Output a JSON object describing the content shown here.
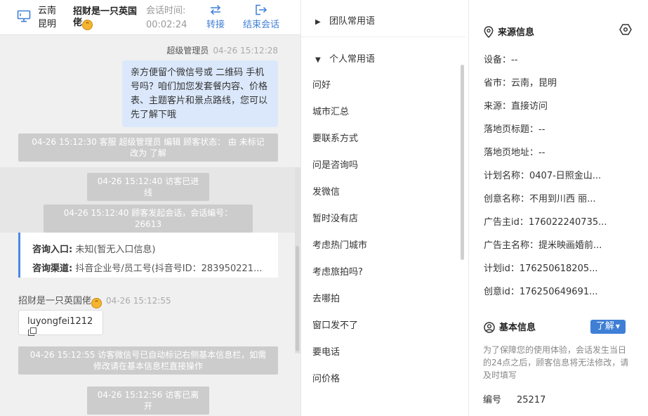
{
  "header": {
    "province": "云南",
    "city": "昆明",
    "visitor_name": "招财是一只英国佬",
    "session_time_label": "会话时间:",
    "session_time_value": "00:02:24",
    "transfer_label": "转接",
    "end_label": "结束会话"
  },
  "messages": {
    "agent_name": "超级管理员",
    "agent_time": "04-26 15:12:28",
    "agent_text": "亲方便留个微信号或 二维码 手机号吗？咱们加您发套餐内容、价格表、主题客片和景点路线，您可以先了解下哦",
    "sys1": "04-26 15:12:30 客服 超级管理员 编辑 顾客状态： 由 未标记 改为 了解",
    "sys2": "04-26 15:12:40 访客已进线",
    "sys3": "04-26 15:12:40 顾客发起会话，会话编号：26613",
    "entry_label": "咨询入口:",
    "entry_value": " 未知(暂无入口信息)",
    "channel_label": "咨询渠道:",
    "channel_value": " 抖音企业号/员工号(抖音号ID：283950221...",
    "visitor_name": "招财是一只英国佬",
    "visitor_time": "04-26 15:12:55",
    "visitor_text": "luyongfei1212",
    "sys4": "04-26 15:12:55 访客微信号已自动标记右侧基本信息栏，如需修改请在基本信息栏直接操作",
    "sys5": "04-26 15:12:56 访客已离开"
  },
  "phrases": {
    "team_group": "团队常用语",
    "personal_group": "个人常用语",
    "items": [
      "问好",
      "城市汇总",
      "要联系方式",
      "问是咨询吗",
      "发微信",
      "暂时没有店",
      "考虑热门城市",
      "考虑旅拍吗?",
      "去哪拍",
      "窗口发不了",
      "要电话",
      "问价格"
    ]
  },
  "source_info": {
    "title": "来源信息",
    "device": "设备：--",
    "region": "省市：云南，昆明",
    "source": "来源：直接访问",
    "landing_title": "落地页标题：--",
    "landing_url": "落地页地址：--",
    "plan_name": "计划名称：0407-日照金山...",
    "creative_name": "创意名称：不用到川西 丽...",
    "advertiser_id": "广告主id：176022240735...",
    "advertiser_name": "广告主名称：提米映画婚前...",
    "plan_id": "计划id：176250618205...",
    "creative_id": "创意id：176250649691..."
  },
  "basic_info": {
    "title": "基本信息",
    "status_button": "了解",
    "notice": "为了保障您的使用体验，会话发生当日的24点之后，顾客信息将无法修改，请及时填写",
    "id_label": "编号",
    "id_value": "25217"
  },
  "colors": {
    "accent": "#3f7fd6",
    "agent_bubble": "#dbe8fb",
    "system_notice": "#cccccc",
    "chat_bg": "#f0f0f0"
  }
}
